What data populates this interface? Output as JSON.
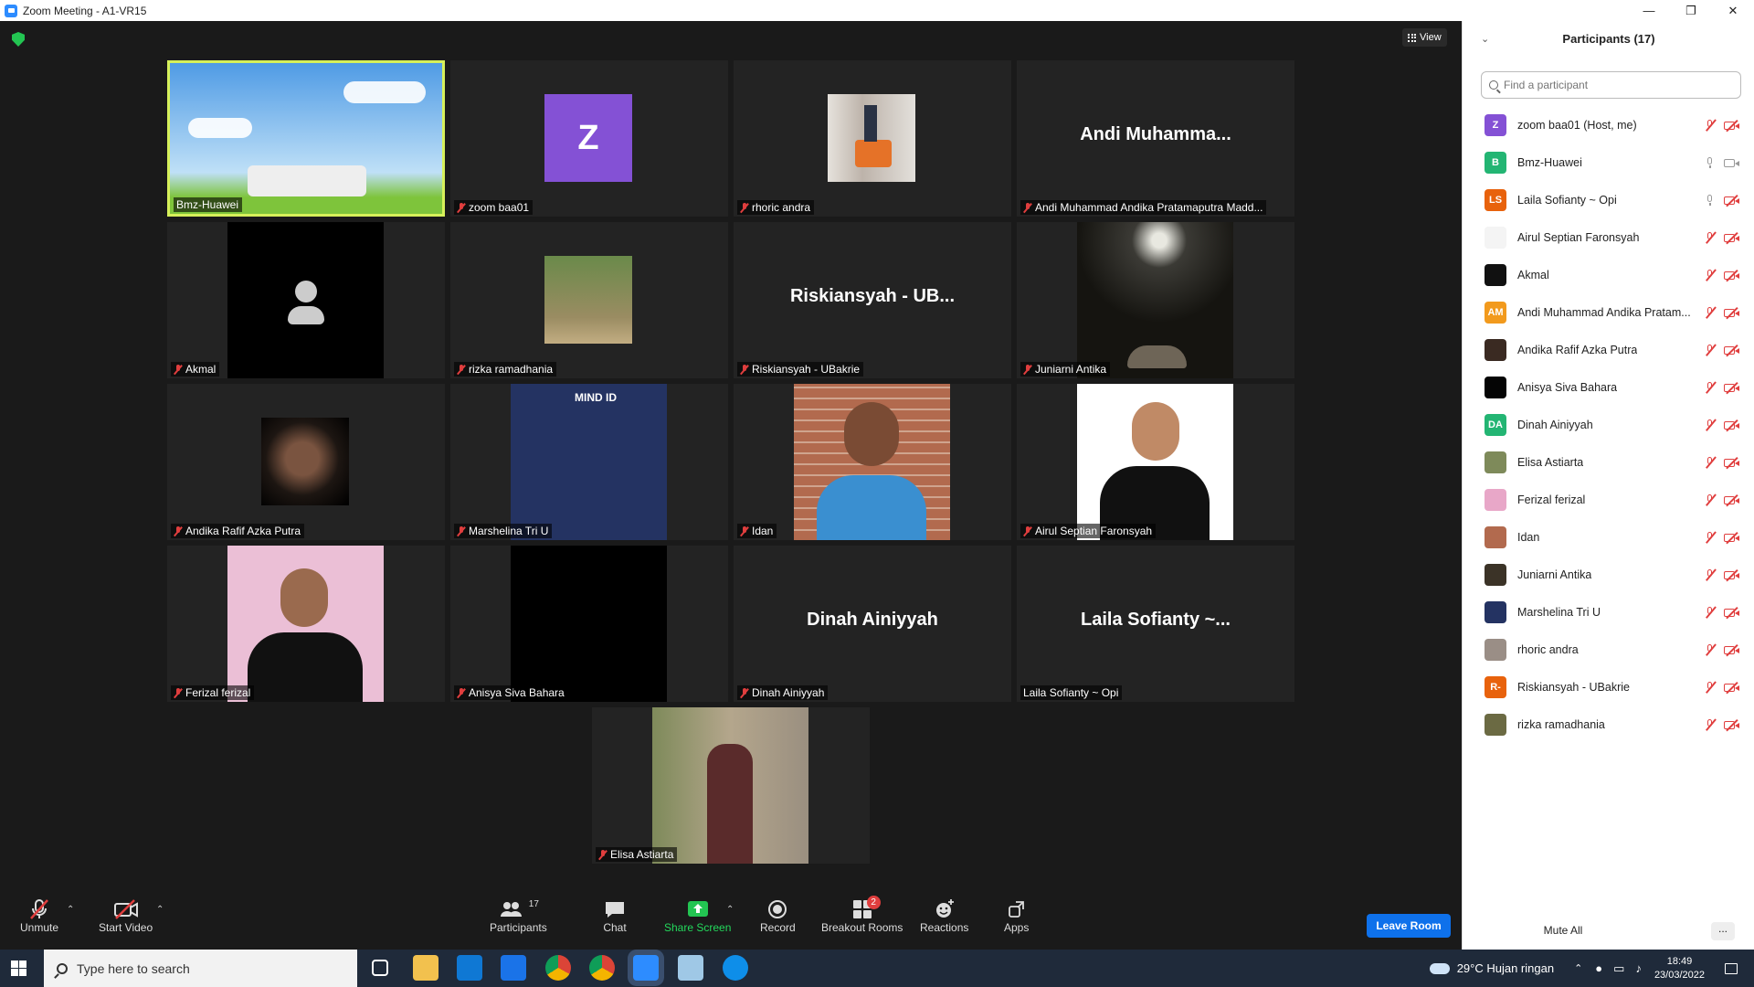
{
  "window": {
    "title": "Zoom Meeting - A1-VR15"
  },
  "meeting": {
    "view_label": "View",
    "tiles": [
      {
        "name": "Bmz-Huawei",
        "muted": false,
        "big": "",
        "kind": "sky"
      },
      {
        "name": "zoom baa01",
        "muted": true,
        "big": "",
        "kind": "z"
      },
      {
        "name": "rhoric andra",
        "muted": true,
        "big": "",
        "kind": "office"
      },
      {
        "name": "Andi Muhammad Andika Pratamaputra Madd...",
        "muted": true,
        "big": "Andi  Muhamma...",
        "kind": "text"
      },
      {
        "name": "Akmal",
        "muted": true,
        "big": "",
        "kind": "person"
      },
      {
        "name": "rizka ramadhania",
        "muted": true,
        "big": "",
        "kind": "forest"
      },
      {
        "name": "Riskiansyah - UBakrie",
        "muted": true,
        "big": "Riskiansyah  - UB...",
        "kind": "text"
      },
      {
        "name": "Juniarni Antika",
        "muted": true,
        "big": "",
        "kind": "night"
      },
      {
        "name": "Andika Rafif Azka Putra",
        "muted": true,
        "big": "",
        "kind": "face-dark"
      },
      {
        "name": "Marshelina Tri U",
        "muted": true,
        "big": "",
        "kind": "mindid",
        "logo": "MIND ID"
      },
      {
        "name": "Idan",
        "muted": true,
        "big": "",
        "kind": "brick"
      },
      {
        "name": "Airul Septian Faronsyah",
        "muted": true,
        "big": "",
        "kind": "suit"
      },
      {
        "name": "Ferizal ferizal",
        "muted": true,
        "big": "",
        "kind": "pink"
      },
      {
        "name": "Anisya Siva Bahara",
        "muted": true,
        "big": "",
        "kind": "black"
      },
      {
        "name": "Dinah Ainiyyah",
        "muted": true,
        "big": "Dinah Ainiyyah",
        "kind": "text"
      },
      {
        "name": "Laila Sofianty ~ Opi",
        "muted": false,
        "big": "Laila  Sofianty  ~...",
        "kind": "text"
      },
      {
        "name": "Elisa Astiarta",
        "muted": true,
        "big": "",
        "kind": "grad"
      }
    ]
  },
  "toolbar": {
    "unmute": "Unmute",
    "start_video": "Start Video",
    "participants": "Participants",
    "participants_count": "17",
    "chat": "Chat",
    "share_screen": "Share Screen",
    "record": "Record",
    "breakout": "Breakout Rooms",
    "breakout_badge": "2",
    "reactions": "Reactions",
    "apps": "Apps",
    "leave": "Leave Room"
  },
  "panel": {
    "title": "Participants (17)",
    "search_placeholder": "Find a participant",
    "participants": [
      {
        "name": "zoom baa01 (Host, me)",
        "initials": "Z",
        "color": "#8451d5",
        "mic": "muted",
        "cam": "off"
      },
      {
        "name": "Bmz-Huawei",
        "initials": "B",
        "color": "#23b573",
        "mic": "on",
        "cam": "on"
      },
      {
        "name": "Laila Sofianty ~ Opi",
        "initials": "LS",
        "color": "#e8620c",
        "mic": "on",
        "cam": "off"
      },
      {
        "name": "Airul Septian Faronsyah",
        "initials": "",
        "color": "#f4f4f4",
        "mic": "muted",
        "cam": "off"
      },
      {
        "name": "Akmal",
        "initials": "",
        "color": "#111111",
        "mic": "muted",
        "cam": "off"
      },
      {
        "name": "Andi Muhammad Andika Pratam...",
        "initials": "AM",
        "color": "#f29a1d",
        "mic": "muted",
        "cam": "off"
      },
      {
        "name": "Andika Rafif Azka Putra",
        "initials": "",
        "color": "#3a2a22",
        "mic": "muted",
        "cam": "off"
      },
      {
        "name": "Anisya Siva Bahara",
        "initials": "",
        "color": "#050505",
        "mic": "muted",
        "cam": "off"
      },
      {
        "name": "Dinah Ainiyyah",
        "initials": "DA",
        "color": "#23b573",
        "mic": "muted",
        "cam": "off"
      },
      {
        "name": "Elisa Astiarta",
        "initials": "",
        "color": "#7e8a5a",
        "mic": "muted",
        "cam": "off"
      },
      {
        "name": "Ferizal ferizal",
        "initials": "",
        "color": "#e8a7c8",
        "mic": "muted",
        "cam": "off"
      },
      {
        "name": "Idan",
        "initials": "",
        "color": "#b26a4e",
        "mic": "muted",
        "cam": "off"
      },
      {
        "name": "Juniarni Antika",
        "initials": "",
        "color": "#3b3327",
        "mic": "muted",
        "cam": "off"
      },
      {
        "name": "Marshelina Tri U",
        "initials": "",
        "color": "#243362",
        "mic": "muted",
        "cam": "off"
      },
      {
        "name": "rhoric andra",
        "initials": "",
        "color": "#9a8e86",
        "mic": "muted",
        "cam": "off"
      },
      {
        "name": "Riskiansyah - UBakrie",
        "initials": "R-",
        "color": "#e8620c",
        "mic": "muted",
        "cam": "off"
      },
      {
        "name": "rizka ramadhania",
        "initials": "",
        "color": "#6b6a43",
        "mic": "muted",
        "cam": "off"
      }
    ],
    "mute_all": "Mute All",
    "more": "..."
  },
  "taskbar": {
    "search_placeholder": "Type here to search",
    "weather": "29°C  Hujan ringan",
    "time": "18:49",
    "date": "23/03/2022"
  }
}
